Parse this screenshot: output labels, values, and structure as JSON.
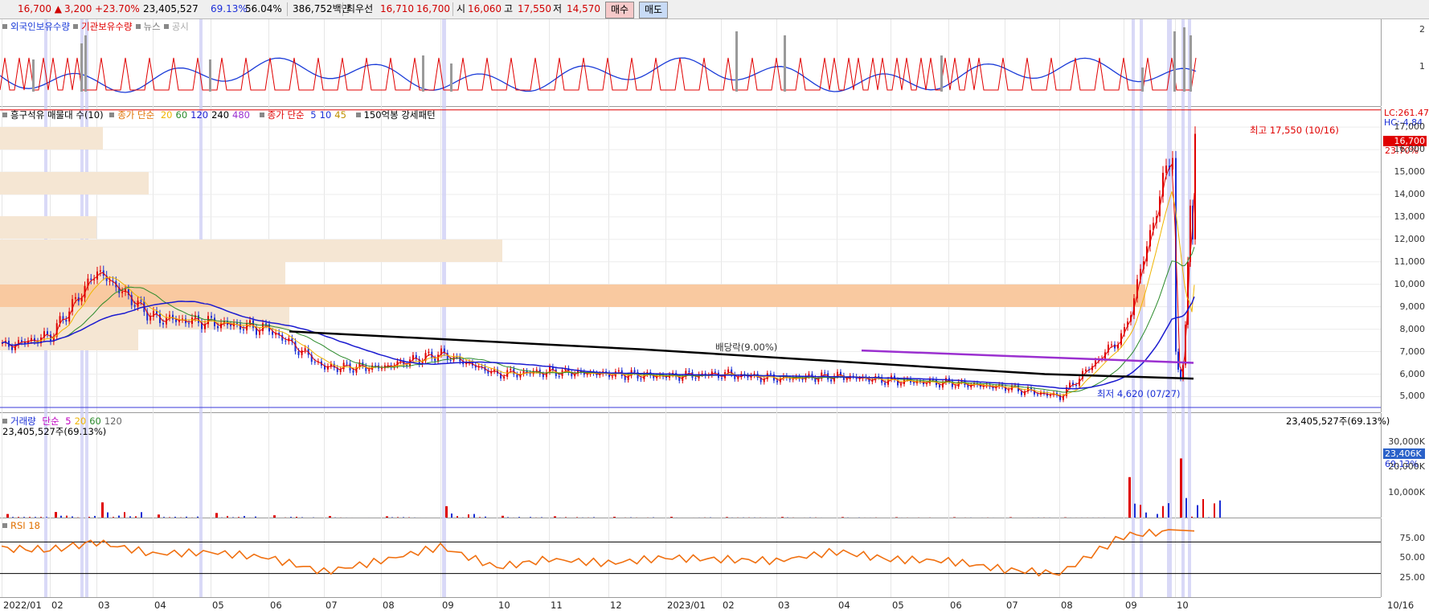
{
  "topbar": {
    "price": "16,700 ▲",
    "change": "3,200",
    "change_pct": "+23.70%",
    "volume": "23,405,527",
    "vol_ratio": "69.13%",
    "foreign_pct": "56.04%",
    "amount": "386,752백만",
    "best_label": "최우선",
    "best_ask": "16,710",
    "best_bid": "16,700",
    "open_label": "시",
    "open": "16,060",
    "high_label": "고",
    "high": "17,550",
    "low_label": "저",
    "low": "14,570",
    "buy_button": "매수",
    "sell_button": "매도"
  },
  "colors": {
    "up": "#e00000",
    "down": "#1a2fd6",
    "ma5": "#e00000",
    "ma10": "#1b3bd0",
    "ma20": "#f0b400",
    "ma60": "#2a8a2a",
    "ma120": "#1a1ad0",
    "ma240": "#000000",
    "ma480": "#9b30d0",
    "rsi": "#f07010",
    "band": "#f5e6d3",
    "band_strong": "#f9c9a0",
    "highlight": "#cfcff5"
  },
  "panel1": {
    "legend": [
      {
        "label": "외국인보유수량",
        "color": "#1a3bd8"
      },
      {
        "label": "기관보유수량",
        "color": "#e00000"
      },
      {
        "label": "뉴스",
        "color": "#777777"
      },
      {
        "label": "공시",
        "color": "#aaaaaa"
      }
    ],
    "yticks": [
      "2",
      "1"
    ]
  },
  "panel2": {
    "legend_a": "흥구석유 매물대 수(10)",
    "legend_b_label": "종가 단순",
    "legend_b": [
      {
        "label": "20",
        "color": "#f0b400"
      },
      {
        "label": "60",
        "color": "#2a8a2a"
      },
      {
        "label": "120",
        "color": "#1a1ad0"
      },
      {
        "label": "240",
        "color": "#000000"
      },
      {
        "label": "480",
        "color": "#9b30d0"
      }
    ],
    "legend_c_label": "종가 단순",
    "legend_c": [
      {
        "label": "5",
        "color": "#1a2fd6"
      },
      {
        "label": "10",
        "color": "#1a2fd6"
      },
      {
        "label": "45",
        "color": "#c09000"
      }
    ],
    "legend_d": "150억봉 강세패턴",
    "yticks": [
      "17,000",
      "16,000",
      "15,000",
      "14,000",
      "13,000",
      "12,000",
      "11,000",
      "10,000",
      "9,000",
      "8,000",
      "7,000",
      "6,000",
      "5,000"
    ],
    "lc": "LC:261.47",
    "hc": "HC:-4.84",
    "price_tag": "16,700",
    "pct_tag": "23.70%",
    "high_note": "최고 17,550 (10/16)",
    "low_note": "최저 4,620 (07/27)",
    "dividend_note": "배당락(9.00%)"
  },
  "panel3": {
    "legend_label": "거래량",
    "legend_sub": "단순",
    "legend": [
      {
        "label": "5",
        "color": "#c000c0"
      },
      {
        "label": "20",
        "color": "#f0b400"
      },
      {
        "label": "60",
        "color": "#2a8a2a"
      },
      {
        "label": "120",
        "color": "#666666"
      }
    ],
    "vol_text": "23,405,527주(69.13%)",
    "vol_text_right": "23,405,527주(69.13%)",
    "yticks": [
      "30,000K",
      "20,000K",
      "10,000K"
    ],
    "vol_tag": "23,406K",
    "vol_pct_tag": "69.13%"
  },
  "panel4": {
    "legend": "RSI 18",
    "yticks": [
      "75.00",
      "50.00",
      "25.00"
    ]
  },
  "xaxis": [
    "2022/01",
    "02",
    "03",
    "04",
    "05",
    "06",
    "07",
    "08",
    "09",
    "10",
    "11",
    "12",
    "2023/01",
    "02",
    "03",
    "04",
    "05",
    "06",
    "07",
    "08",
    "09",
    "10",
    "10/16"
  ],
  "chart_data": {
    "type": "candlestick",
    "ylim": [
      4300,
      17900
    ],
    "x": [
      "2022/01",
      "02",
      "03",
      "04",
      "05",
      "06",
      "07",
      "08",
      "09",
      "10",
      "11",
      "12",
      "2023/01",
      "02",
      "03",
      "04",
      "05",
      "06",
      "07",
      "08",
      "09",
      "10"
    ],
    "close": [
      7200,
      7700,
      10600,
      8500,
      8300,
      8000,
      6300,
      6300,
      6900,
      6000,
      6100,
      6000,
      5900,
      6000,
      5800,
      5900,
      5700,
      5600,
      5400,
      5000,
      7800,
      16700
    ],
    "volume_k": [
      1400,
      2200,
      6000,
      1200,
      1800,
      900,
      600,
      500,
      4500,
      700,
      500,
      300,
      300,
      200,
      250,
      200,
      150,
      150,
      150,
      100,
      16000,
      23406
    ],
    "rsi": [
      62,
      60,
      70,
      55,
      57,
      50,
      32,
      46,
      64,
      38,
      48,
      43,
      50,
      48,
      46,
      58,
      48,
      46,
      35,
      30,
      78,
      84
    ],
    "high_point": {
      "value": 17550,
      "date": "10/16"
    },
    "low_point": {
      "value": 4620,
      "date": "07/27"
    },
    "hlines": [
      7300,
      4600
    ],
    "rsi_levels": [
      70,
      30
    ]
  }
}
